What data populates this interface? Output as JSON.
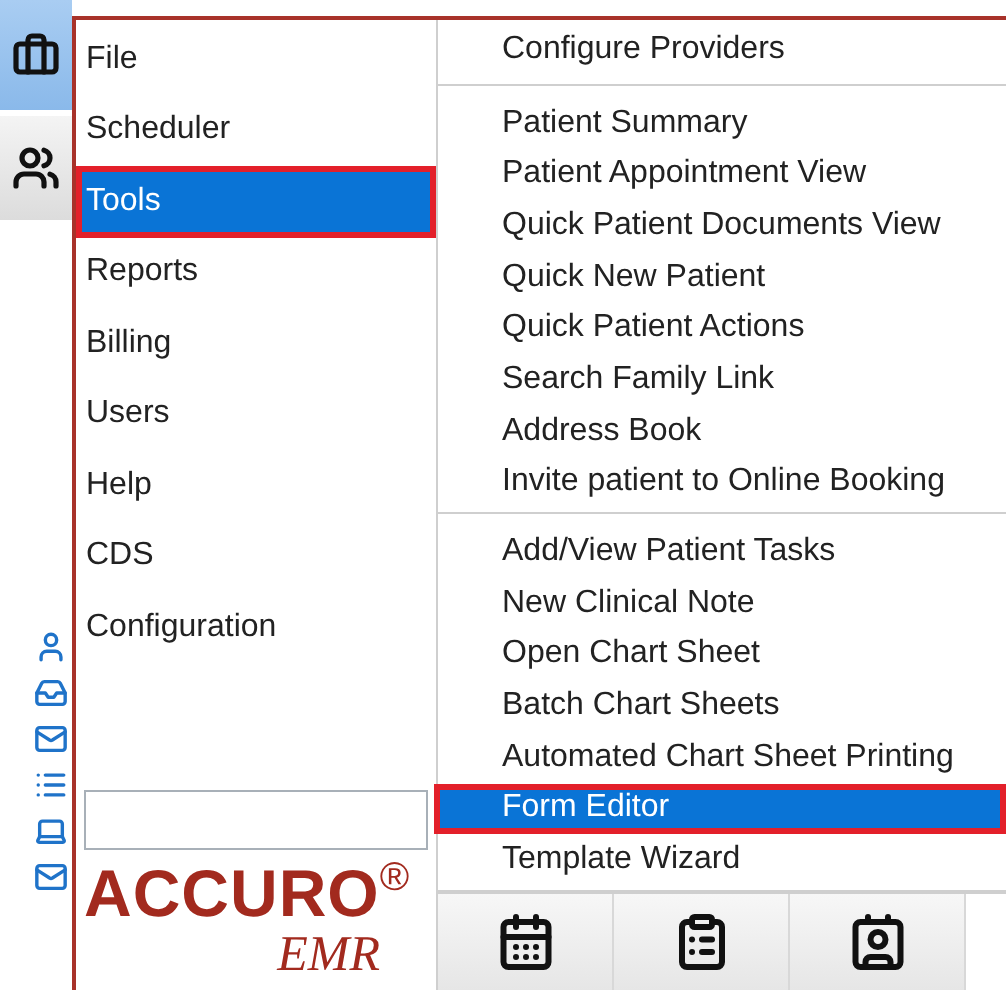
{
  "main_menu": [
    {
      "label": "File",
      "selected": false
    },
    {
      "label": "Scheduler",
      "selected": false
    },
    {
      "label": "Tools",
      "selected": true
    },
    {
      "label": "Reports",
      "selected": false
    },
    {
      "label": "Billing",
      "selected": false
    },
    {
      "label": "Users",
      "selected": false
    },
    {
      "label": "Help",
      "selected": false
    },
    {
      "label": "CDS",
      "selected": false
    },
    {
      "label": "Configuration",
      "selected": false
    }
  ],
  "submenu_groups": [
    [
      {
        "label": "Configure Providers",
        "selected": false
      }
    ],
    [
      {
        "label": "Patient Summary",
        "selected": false
      },
      {
        "label": "Patient Appointment View",
        "selected": false
      },
      {
        "label": "Quick Patient Documents View",
        "selected": false
      },
      {
        "label": "Quick New Patient",
        "selected": false
      },
      {
        "label": "Quick Patient Actions",
        "selected": false
      },
      {
        "label": "Search Family Link",
        "selected": false
      },
      {
        "label": "Address Book",
        "selected": false
      },
      {
        "label": "Invite patient to Online Booking",
        "selected": false
      }
    ],
    [
      {
        "label": "Add/View Patient Tasks",
        "selected": false
      },
      {
        "label": "New Clinical Note",
        "selected": false
      },
      {
        "label": "Open Chart Sheet",
        "selected": false
      },
      {
        "label": "Batch Chart Sheets",
        "selected": false
      },
      {
        "label": "Automated Chart Sheet Printing",
        "selected": false
      },
      {
        "label": "Form Editor",
        "selected": true
      },
      {
        "label": "Template Wizard",
        "selected": false
      }
    ]
  ],
  "logo": {
    "name": "ACCURO",
    "mark": "®",
    "product": "EMR"
  },
  "toolbar": [
    {
      "kind": "calendar"
    },
    {
      "kind": "clipboard"
    },
    {
      "kind": "address-book"
    }
  ],
  "side_tools": [
    {
      "kind": "briefcase",
      "selected": true
    },
    {
      "kind": "group",
      "selected": false
    }
  ],
  "side_icons": [
    {
      "kind": "person"
    },
    {
      "kind": "inbox"
    },
    {
      "kind": "mail"
    },
    {
      "kind": "list"
    },
    {
      "kind": "laptop"
    },
    {
      "kind": "mail"
    }
  ]
}
